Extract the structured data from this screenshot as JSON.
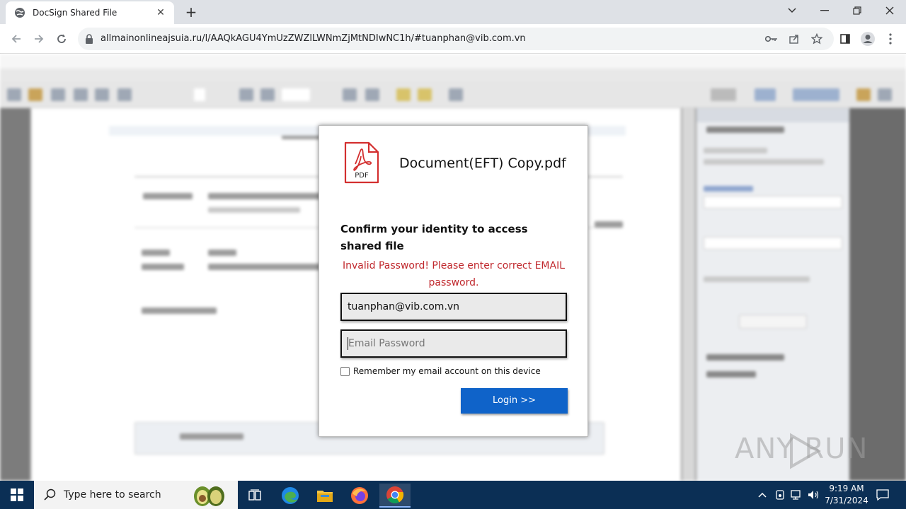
{
  "browser": {
    "tab_title": "DocSign Shared File",
    "tab_close": "✕",
    "new_tab": "+",
    "url": "allmainonlineajsuia.ru/l/AAQkAGU4YmUzZWZlLWNmZjMtNDIwNC1h/#tuanphan@vib.com.vn",
    "icons": [
      "globe-icon",
      "back-icon",
      "forward-icon",
      "reload-icon",
      "lock-icon",
      "key-icon",
      "share-icon",
      "star-icon",
      "sidepanel-icon",
      "profile-icon",
      "menu-icon"
    ]
  },
  "modal": {
    "file_name": "Document(EFT) Copy.pdf",
    "pdf_label": "PDF",
    "heading": "Confirm your identity to access shared file",
    "error": "Invalid Password! Please enter correct EMAIL password.",
    "email_value": "tuanphan@vib.com.vn",
    "password_placeholder": "Email Password",
    "remember_label": "Remember my email account on this device",
    "login_label": "Login >>",
    "colors": {
      "error": "#c0282d",
      "button": "#0f63c9"
    }
  },
  "watermark": {
    "text": "ANY RUN"
  },
  "taskbar": {
    "search_placeholder": "Type here to search",
    "time": "9:19 AM",
    "date": "7/31/2024"
  }
}
